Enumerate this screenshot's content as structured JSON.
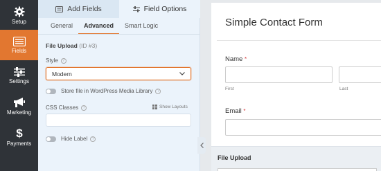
{
  "rail": {
    "items": [
      {
        "label": "Setup",
        "icon": "gear-icon",
        "active": false
      },
      {
        "label": "Fields",
        "icon": "fields-list-icon",
        "active": true
      },
      {
        "label": "Settings",
        "icon": "sliders-icon",
        "active": false
      },
      {
        "label": "Marketing",
        "icon": "megaphone-icon",
        "active": false
      },
      {
        "label": "Payments",
        "icon": "dollar-icon",
        "active": false
      }
    ],
    "accent": "#e27730",
    "background": "#2f3338"
  },
  "panel": {
    "tabs": [
      {
        "label": "Add Fields",
        "icon": "list-icon",
        "active": false
      },
      {
        "label": "Field Options",
        "icon": "sliders-icon",
        "active": true
      }
    ],
    "subtabs": [
      {
        "label": "General",
        "active": false
      },
      {
        "label": "Advanced",
        "active": true
      },
      {
        "label": "Smart Logic",
        "active": false
      }
    ],
    "section_title": "File Upload",
    "section_id": "(ID #3)",
    "style_label": "Style",
    "style_value": "Modern",
    "media_toggle_label": "Store file in WordPress Media Library",
    "css_classes_label": "CSS Classes",
    "show_layouts_label": "Show Layouts",
    "css_classes_value": "",
    "hide_label_label": "Hide Label"
  },
  "preview": {
    "form_title": "Simple Contact Form",
    "fields": {
      "name_label": "Name",
      "first_sub": "First",
      "last_sub": "Last",
      "email_label": "Email",
      "file_upload_label": "File Upload",
      "required_mark": "*"
    }
  }
}
